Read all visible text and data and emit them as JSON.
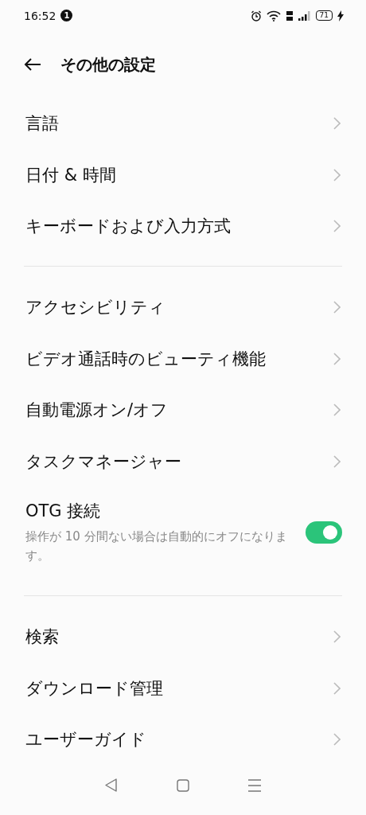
{
  "status_bar": {
    "time": "16:52",
    "notification_count": "1",
    "battery": "71"
  },
  "header": {
    "title": "その他の設定"
  },
  "sections": [
    {
      "items": [
        {
          "kind": "link",
          "label": "言語"
        },
        {
          "kind": "link",
          "label": "日付 & 時間"
        },
        {
          "kind": "link",
          "label": "キーボードおよび入力方式"
        }
      ]
    },
    {
      "items": [
        {
          "kind": "link",
          "label": "アクセシビリティ"
        },
        {
          "kind": "link",
          "label": "ビデオ通話時のビューティ機能"
        },
        {
          "kind": "link",
          "label": "自動電源オン/オフ"
        },
        {
          "kind": "link",
          "label": "タスクマネージャー"
        },
        {
          "kind": "toggle",
          "label": "OTG 接続",
          "description": "操作が 10 分間ない場合は自動的にオフになります。",
          "on": true
        }
      ]
    },
    {
      "items": [
        {
          "kind": "link",
          "label": "検索"
        },
        {
          "kind": "link",
          "label": "ダウンロード管理"
        },
        {
          "kind": "link",
          "label": "ユーザーガイド"
        }
      ]
    }
  ]
}
